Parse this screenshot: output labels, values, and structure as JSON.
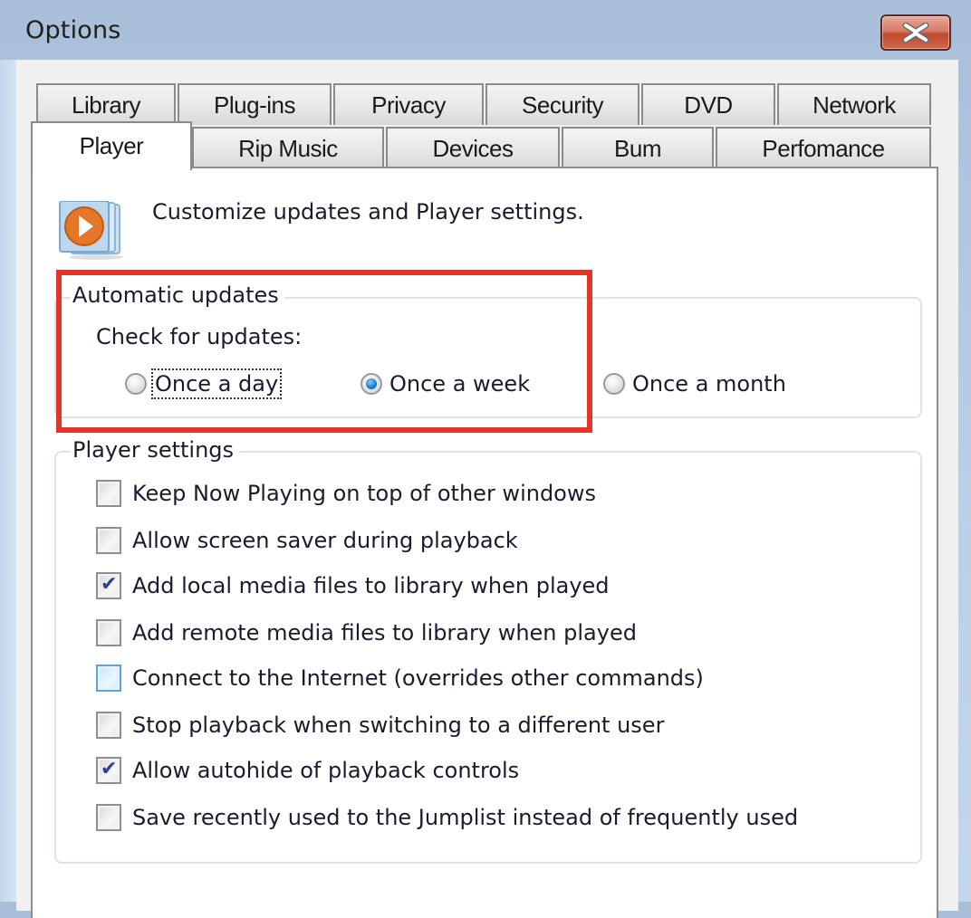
{
  "window": {
    "title": "Options",
    "close_icon": "close-x-icon"
  },
  "tabs": {
    "row_back": [
      {
        "label": "Library"
      },
      {
        "label": "Plug-ins"
      },
      {
        "label": "Privacy"
      },
      {
        "label": "Security"
      },
      {
        "label": "DVD"
      },
      {
        "label": "Network"
      }
    ],
    "row_front": [
      {
        "label": "Player",
        "active": true
      },
      {
        "label": "Rip Music"
      },
      {
        "label": "Devices"
      },
      {
        "label": "Bum"
      },
      {
        "label": "Perfomance"
      }
    ]
  },
  "player_tab": {
    "icon": "media-player-icon",
    "intro": "Customize updates and Player settings.",
    "automatic_updates": {
      "legend": "Automatic updates",
      "check_label": "Check for updates:",
      "options": [
        {
          "label": "Once a day",
          "selected": false,
          "focused": true
        },
        {
          "label": "Once a week",
          "selected": true
        },
        {
          "label": "Once a month",
          "selected": false
        }
      ]
    },
    "player_settings": {
      "legend": "Player settings",
      "items": [
        {
          "label": "Keep Now Playing on top of other windows",
          "checked": false
        },
        {
          "label": "Allow screen saver during playback",
          "checked": false
        },
        {
          "label": "Add local media files to library when played",
          "checked": true
        },
        {
          "label": "Add remote media files to library when played",
          "checked": false
        },
        {
          "label": "Connect to the Internet (overrides other commands)",
          "checked": false,
          "hover": true
        },
        {
          "label": "Stop playback when switching to a different user",
          "checked": false
        },
        {
          "label": "Allow autohide of playback controls",
          "checked": true
        },
        {
          "label": "Save recently used to the Jumplist instead of frequently used",
          "checked": false
        }
      ]
    }
  },
  "annotation": {
    "highlight_color": "#e3352b"
  }
}
